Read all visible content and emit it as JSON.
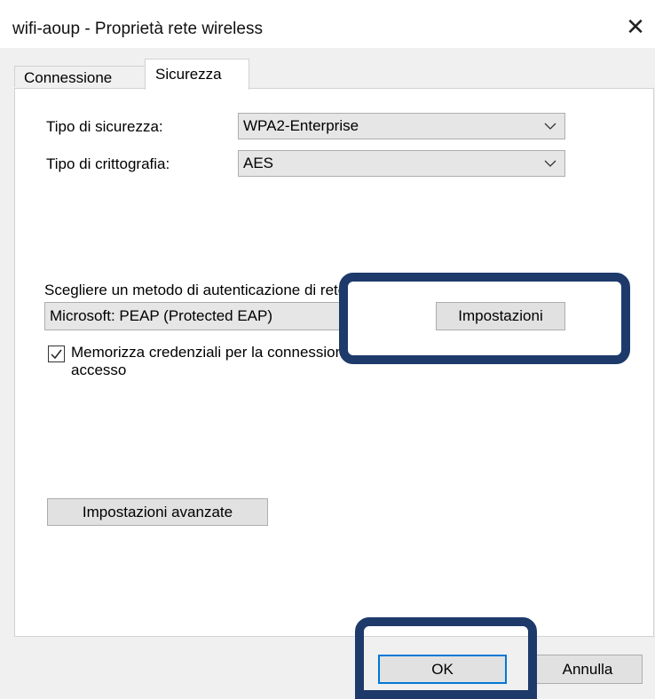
{
  "window": {
    "title": "wifi-aoup - Proprietà rete wireless",
    "close_icon": "close-icon"
  },
  "tabs": [
    {
      "label": "Connessione",
      "selected": false
    },
    {
      "label": "Sicurezza",
      "selected": true
    }
  ],
  "security": {
    "type_label": "Tipo di sicurezza:",
    "type_value": "WPA2-Enterprise",
    "encryption_label": "Tipo di crittografia:",
    "encryption_value": "AES"
  },
  "auth": {
    "method_label": "Scegliere un metodo di autenticazione di rete:",
    "method_value": "Microsoft: PEAP (Protected EAP)",
    "settings_button": "Impostazioni",
    "remember_checked": true,
    "remember_label_line1": "Memorizza credenziali per la connessione a ogni",
    "remember_label_line2": "accesso"
  },
  "advanced_button": "Impostazioni avanzate",
  "footer": {
    "ok": "OK",
    "cancel": "Annulla"
  },
  "colors": {
    "highlight": "#1d3a6b",
    "focus_border": "#0078d7"
  }
}
